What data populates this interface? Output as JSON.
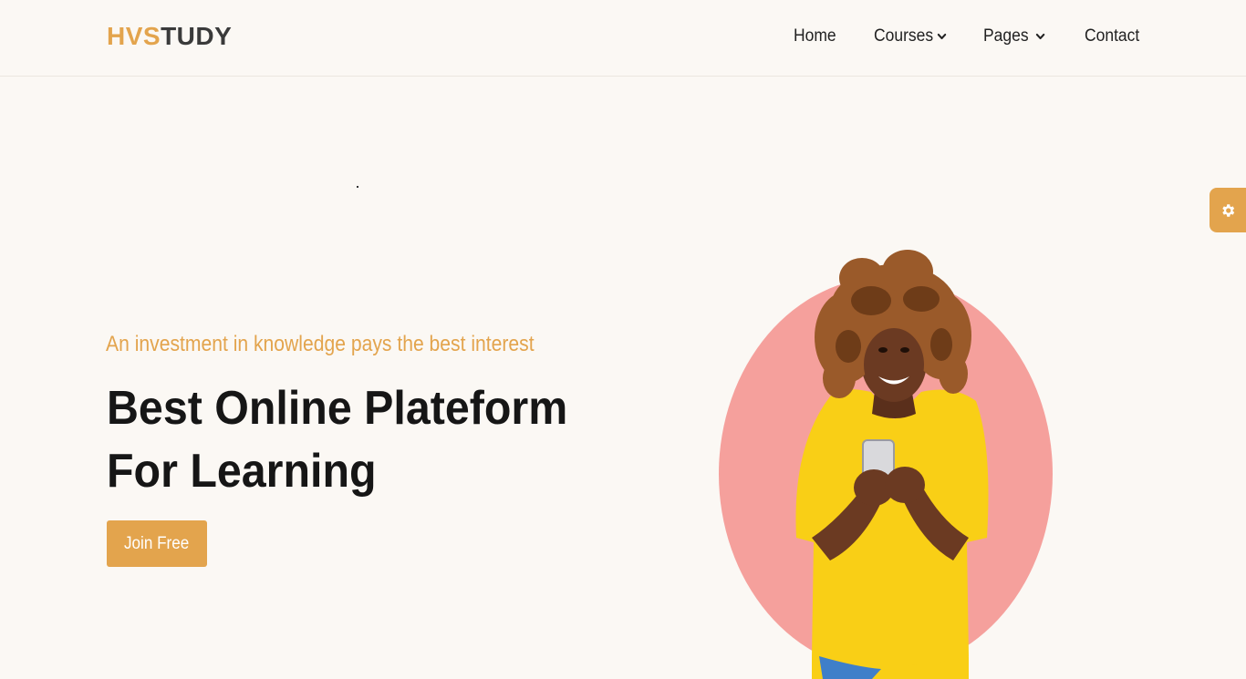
{
  "brand": {
    "logo_accent": "HVS",
    "logo_rest": "TUDY",
    "accent_color": "#e3a44d",
    "dark_color": "#3a3a3a"
  },
  "nav": {
    "home": "Home",
    "courses": "Courses",
    "pages": "Pages",
    "contact": "Contact"
  },
  "settings": {
    "icon": "gear-icon"
  },
  "hero": {
    "tagline": "An investment in knowledge pays the best interest",
    "headline_line1": "Best Online Plateform",
    "headline_line2": "For Learning",
    "cta_label": "Join Free",
    "image_icon": "student-with-phone-illustration"
  },
  "colors": {
    "page_bg": "#fbf8f4",
    "circle": "#f5a09c",
    "shirt": "#f9cf16",
    "skin": "#6b3a22",
    "hair": "#9a5a2a"
  }
}
